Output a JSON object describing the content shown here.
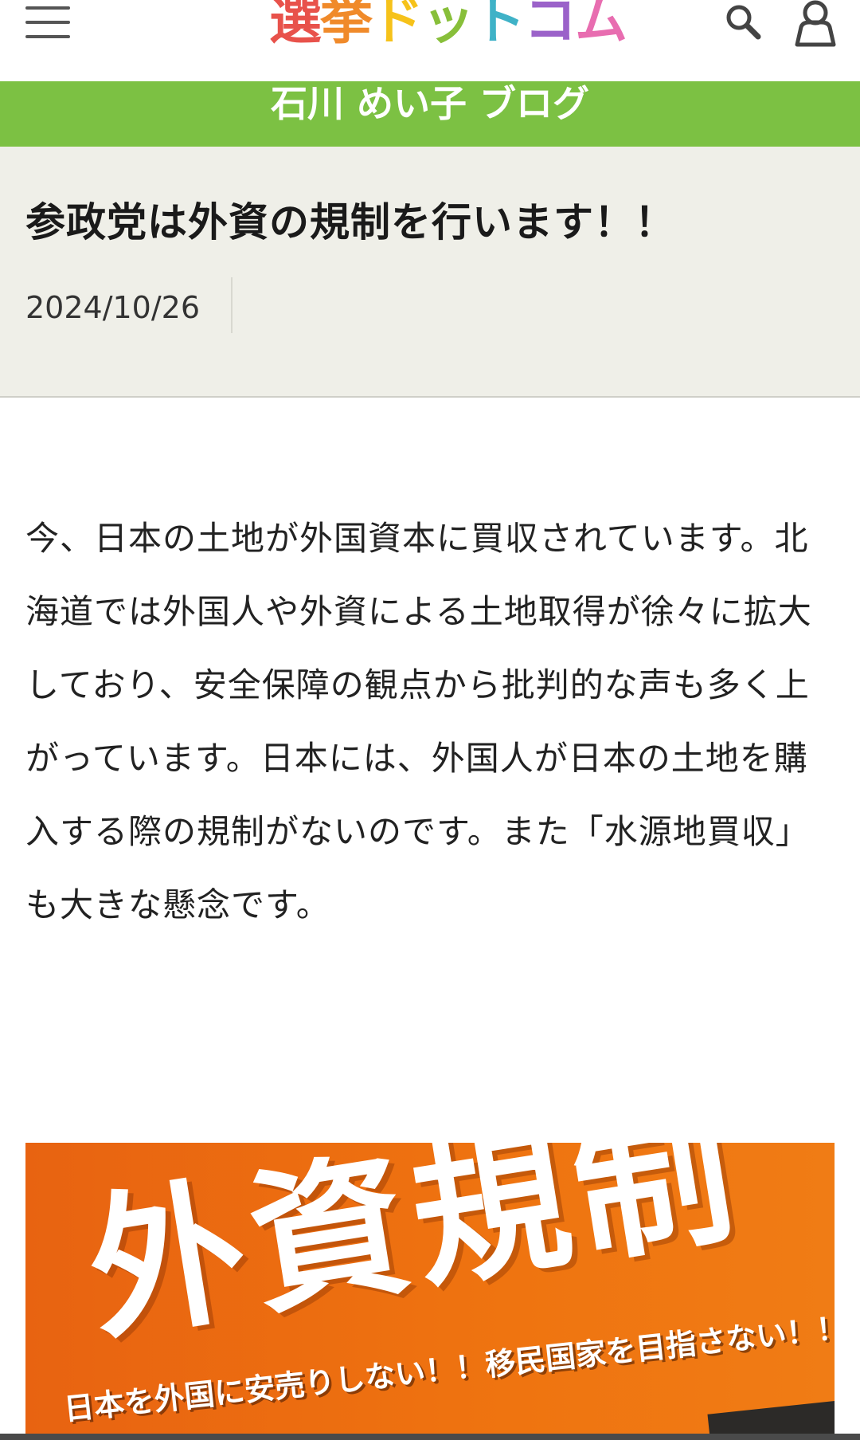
{
  "header": {
    "menu_icon": "hamburger-menu-icon",
    "logo": {
      "parts": [
        "選",
        "挙",
        "ド",
        "ッ",
        "ト",
        "コ",
        "ム"
      ],
      "colors": [
        "#e8524b",
        "#f08a2a",
        "#f6c21a",
        "#88bf3a",
        "#3fb2c7",
        "#9b62c9",
        "#e86db0"
      ]
    },
    "search_icon": "search-icon",
    "account_icon": "user-account-icon"
  },
  "banner": {
    "title": "石川 めい子 ブログ",
    "color": "#7cc143"
  },
  "article": {
    "title": "参政党は外資の規制を行います！！",
    "date": "2024/10/26",
    "body": "今、日本の土地が外国資本に買収されています。北海道では外国人や外資による土地取得が徐々に拡大しており、安全保障の観点から批判的な声も多く上がっています。日本には、外国人が日本の土地を購入する際の規制がないのです。また「水源地買収」も大きな懸念です。"
  },
  "image": {
    "headline": "外資規制",
    "subline": "日本を外国に安売りしない！！移民国家を目指さない！！",
    "color": "#ef7410"
  }
}
